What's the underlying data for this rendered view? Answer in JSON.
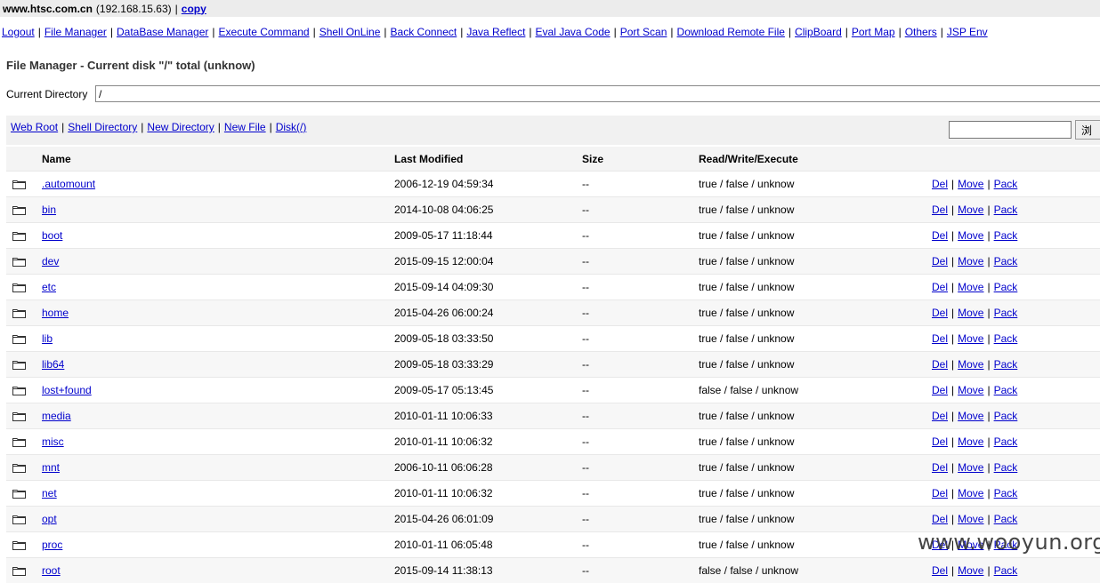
{
  "header": {
    "host": "www.htsc.com.cn",
    "ip": "(192.168.15.63)",
    "separator": "|",
    "copy_label": "copy"
  },
  "nav": [
    "Logout",
    "File Manager",
    "DataBase Manager",
    "Execute Command",
    "Shell OnLine",
    "Back Connect",
    "Java Reflect",
    "Eval Java Code",
    "Port Scan",
    "Download Remote File",
    "ClipBoard",
    "Port Map",
    "Others",
    "JSP Env"
  ],
  "page_title": "File Manager - Current disk \"/\" total (unknow)",
  "current_directory": {
    "label": "Current Directory",
    "value": "/"
  },
  "toolbar": {
    "links": [
      "Web Root",
      "Shell Directory",
      "New Directory",
      "New File",
      "Disk(/)"
    ],
    "search_value": "",
    "go_label": "浏"
  },
  "table": {
    "headers": {
      "name": "Name",
      "modified": "Last Modified",
      "size": "Size",
      "rwx": "Read/Write/Execute"
    },
    "action_labels": {
      "del": "Del",
      "move": "Move",
      "pack": "Pack"
    },
    "rows": [
      {
        "name": ".automount",
        "modified": "2006-12-19 04:59:34",
        "size": "--",
        "rwx": "true / false / unknow"
      },
      {
        "name": "bin",
        "modified": "2014-10-08 04:06:25",
        "size": "--",
        "rwx": "true / false / unknow"
      },
      {
        "name": "boot",
        "modified": "2009-05-17 11:18:44",
        "size": "--",
        "rwx": "true / false / unknow"
      },
      {
        "name": "dev",
        "modified": "2015-09-15 12:00:04",
        "size": "--",
        "rwx": "true / false / unknow"
      },
      {
        "name": "etc",
        "modified": "2015-09-14 04:09:30",
        "size": "--",
        "rwx": "true / false / unknow"
      },
      {
        "name": "home",
        "modified": "2015-04-26 06:00:24",
        "size": "--",
        "rwx": "true / false / unknow"
      },
      {
        "name": "lib",
        "modified": "2009-05-18 03:33:50",
        "size": "--",
        "rwx": "true / false / unknow"
      },
      {
        "name": "lib64",
        "modified": "2009-05-18 03:33:29",
        "size": "--",
        "rwx": "true / false / unknow"
      },
      {
        "name": "lost+found",
        "modified": "2009-05-17 05:13:45",
        "size": "--",
        "rwx": "false / false / unknow"
      },
      {
        "name": "media",
        "modified": "2010-01-11 10:06:33",
        "size": "--",
        "rwx": "true / false / unknow"
      },
      {
        "name": "misc",
        "modified": "2010-01-11 10:06:32",
        "size": "--",
        "rwx": "true / false / unknow"
      },
      {
        "name": "mnt",
        "modified": "2006-10-11 06:06:28",
        "size": "--",
        "rwx": "true / false / unknow"
      },
      {
        "name": "net",
        "modified": "2010-01-11 10:06:32",
        "size": "--",
        "rwx": "true / false / unknow"
      },
      {
        "name": "opt",
        "modified": "2015-04-26 06:01:09",
        "size": "--",
        "rwx": "true / false / unknow"
      },
      {
        "name": "proc",
        "modified": "2010-01-11 06:05:48",
        "size": "--",
        "rwx": "true / false / unknow"
      },
      {
        "name": "root",
        "modified": "2015-09-14 11:38:13",
        "size": "--",
        "rwx": "false / false / unknow"
      }
    ]
  },
  "watermark": "www.wooyun.org",
  "icons": {
    "folder": "folder-icon"
  }
}
